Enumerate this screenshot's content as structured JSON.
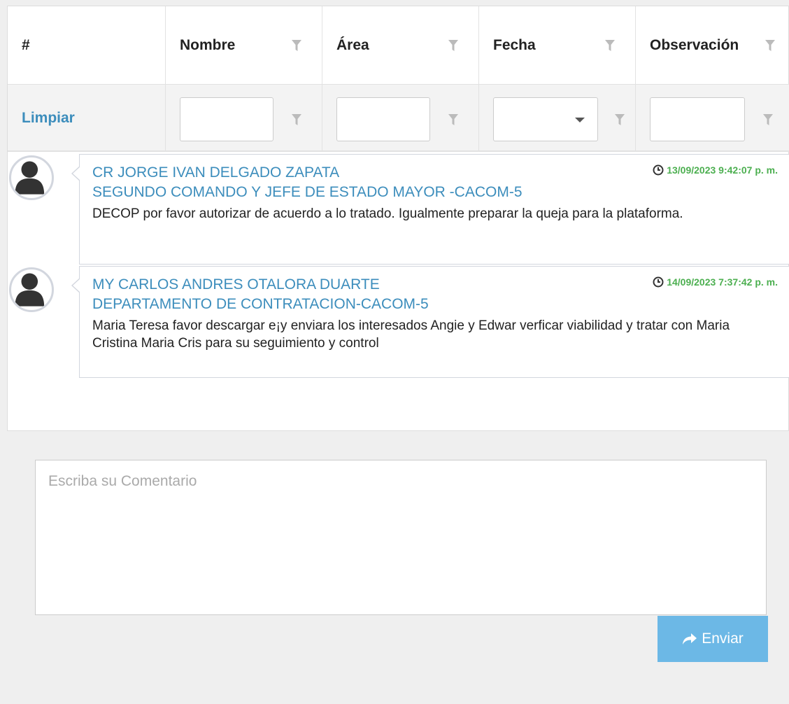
{
  "grid": {
    "columns": [
      {
        "label": "#"
      },
      {
        "label": "Nombre"
      },
      {
        "label": "Área"
      },
      {
        "label": "Fecha"
      },
      {
        "label": "Observación"
      }
    ],
    "clear_filters_label": "Limpiar",
    "filter_values": {
      "nombre": "",
      "area": "",
      "fecha": "",
      "observacion": ""
    }
  },
  "comments": [
    {
      "name": "CR JORGE IVAN DELGADO ZAPATA",
      "department": "SEGUNDO COMANDO Y JEFE DE ESTADO MAYOR -CACOM-5",
      "timestamp": "13/09/2023 9:42:07 p. m.",
      "text": "DECOP por favor autorizar de acuerdo a lo tratado. Igualmente preparar la queja para la plataforma."
    },
    {
      "name": "MY CARLOS ANDRES OTALORA DUARTE",
      "department": "DEPARTAMENTO DE CONTRATACION-CACOM-5",
      "timestamp": "14/09/2023 7:37:42 p. m.",
      "text": "Maria Teresa favor descargar e¡y enviara los interesados Angie y Edwar verficar viabilidad y tratar con Maria Cristina Maria Cris para su seguimiento y control"
    }
  ],
  "composer": {
    "placeholder": "Escriba su Comentario",
    "value": "",
    "send_label": "Enviar"
  },
  "colors": {
    "link": "#3c8dbc",
    "timestamp": "#4caf50",
    "send_button": "#6cb8e6"
  },
  "icons": {
    "filter": "filter-icon",
    "clock": "clock-icon",
    "avatar": "user-avatar-icon",
    "send": "share-arrow-icon"
  }
}
